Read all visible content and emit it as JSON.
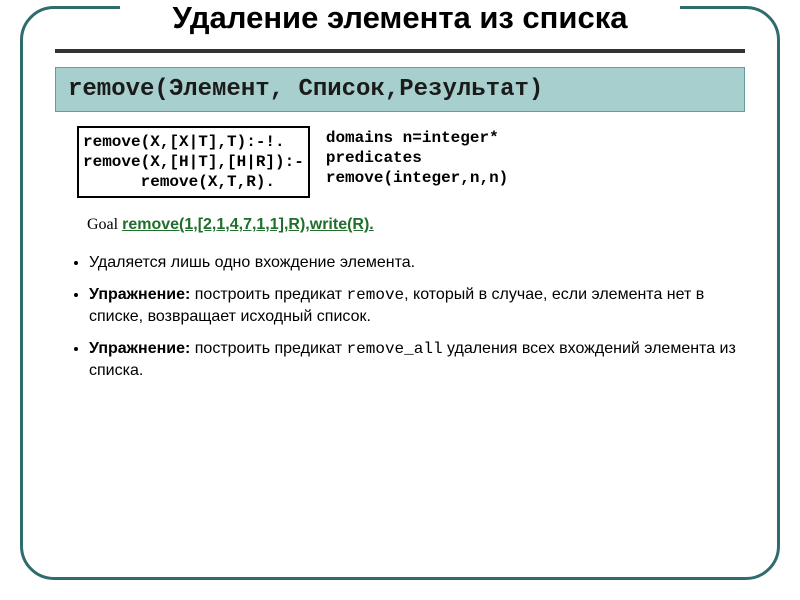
{
  "title": "Удаление элемента из списка",
  "signature": "remove(Элемент, Список,Результат)",
  "code_box": "remove(X,[X|T],T):-!.\nremove(X,[H|T],[H|R]):-\n      remove(X,T,R).",
  "domains_block": "domains n=integer*\npredicates\nremove(integer,n,n)",
  "goal": {
    "label": "Goal ",
    "code": "remove(1,[2,1,4,7,1,1],R),write(R)."
  },
  "bullets": [
    {
      "text": "Удаляется лишь одно вхождение элемента."
    },
    {
      "bold": "Упражнение:",
      "text": " построить предикат ",
      "mono": "remove",
      "text2": ", который в случае, если элемента нет в списке, возвращает исходный список."
    },
    {
      "bold": "Упражнение:",
      "text": " построить предикат ",
      "mono": "remove_all",
      "text2": " удаления всех вхождений элемента из списка."
    }
  ]
}
